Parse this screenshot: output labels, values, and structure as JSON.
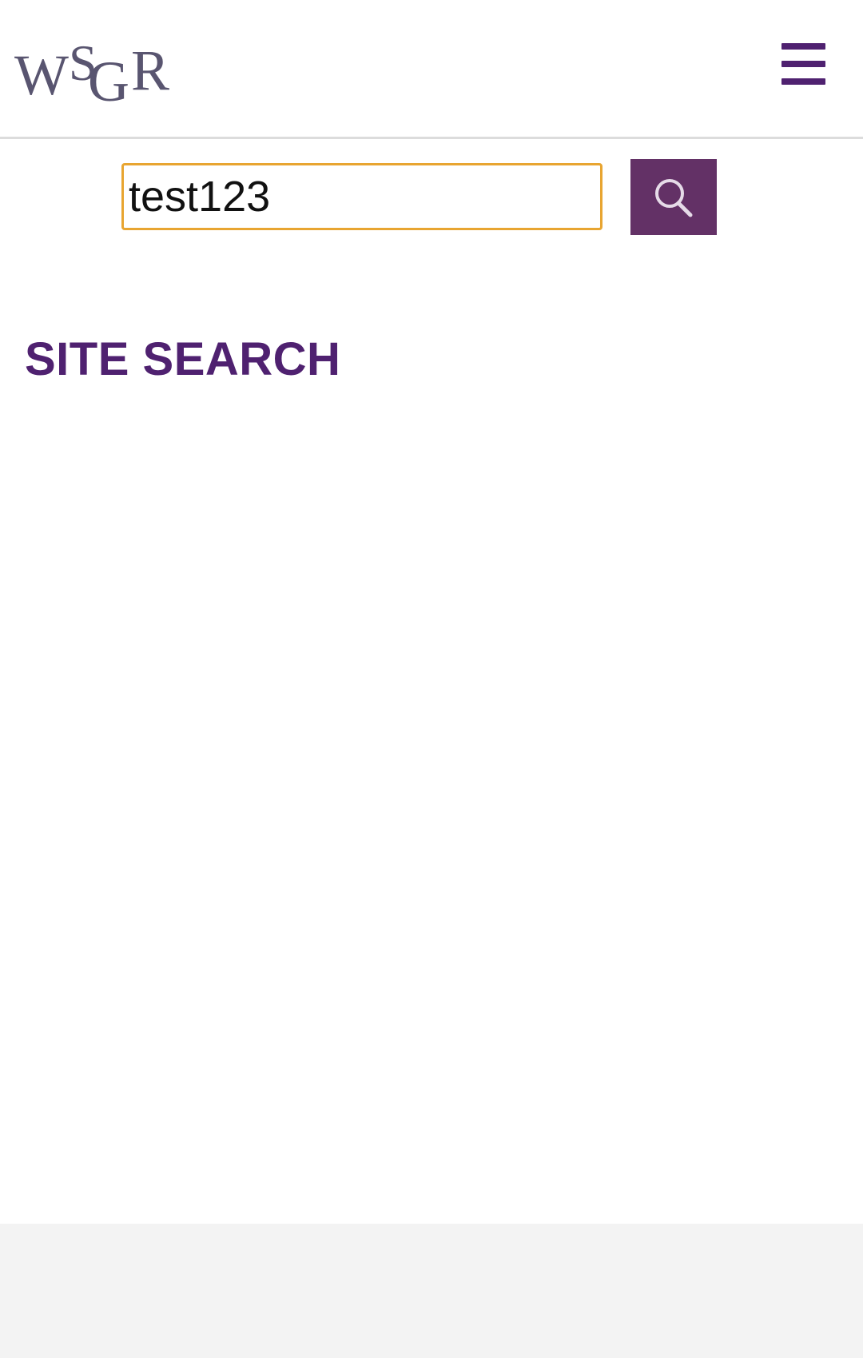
{
  "header": {
    "logo_text": "WSGR",
    "logo_icon": "wsgr-logo",
    "menu_icon": "hamburger-menu-icon"
  },
  "search": {
    "value": "test123",
    "button_icon": "search-icon"
  },
  "main": {
    "title": "SITE SEARCH"
  },
  "colors": {
    "brand_purple": "#4f2170",
    "button_purple": "#633166",
    "input_focus_border": "#e8a531",
    "footer_bg": "#f3f3f3"
  }
}
